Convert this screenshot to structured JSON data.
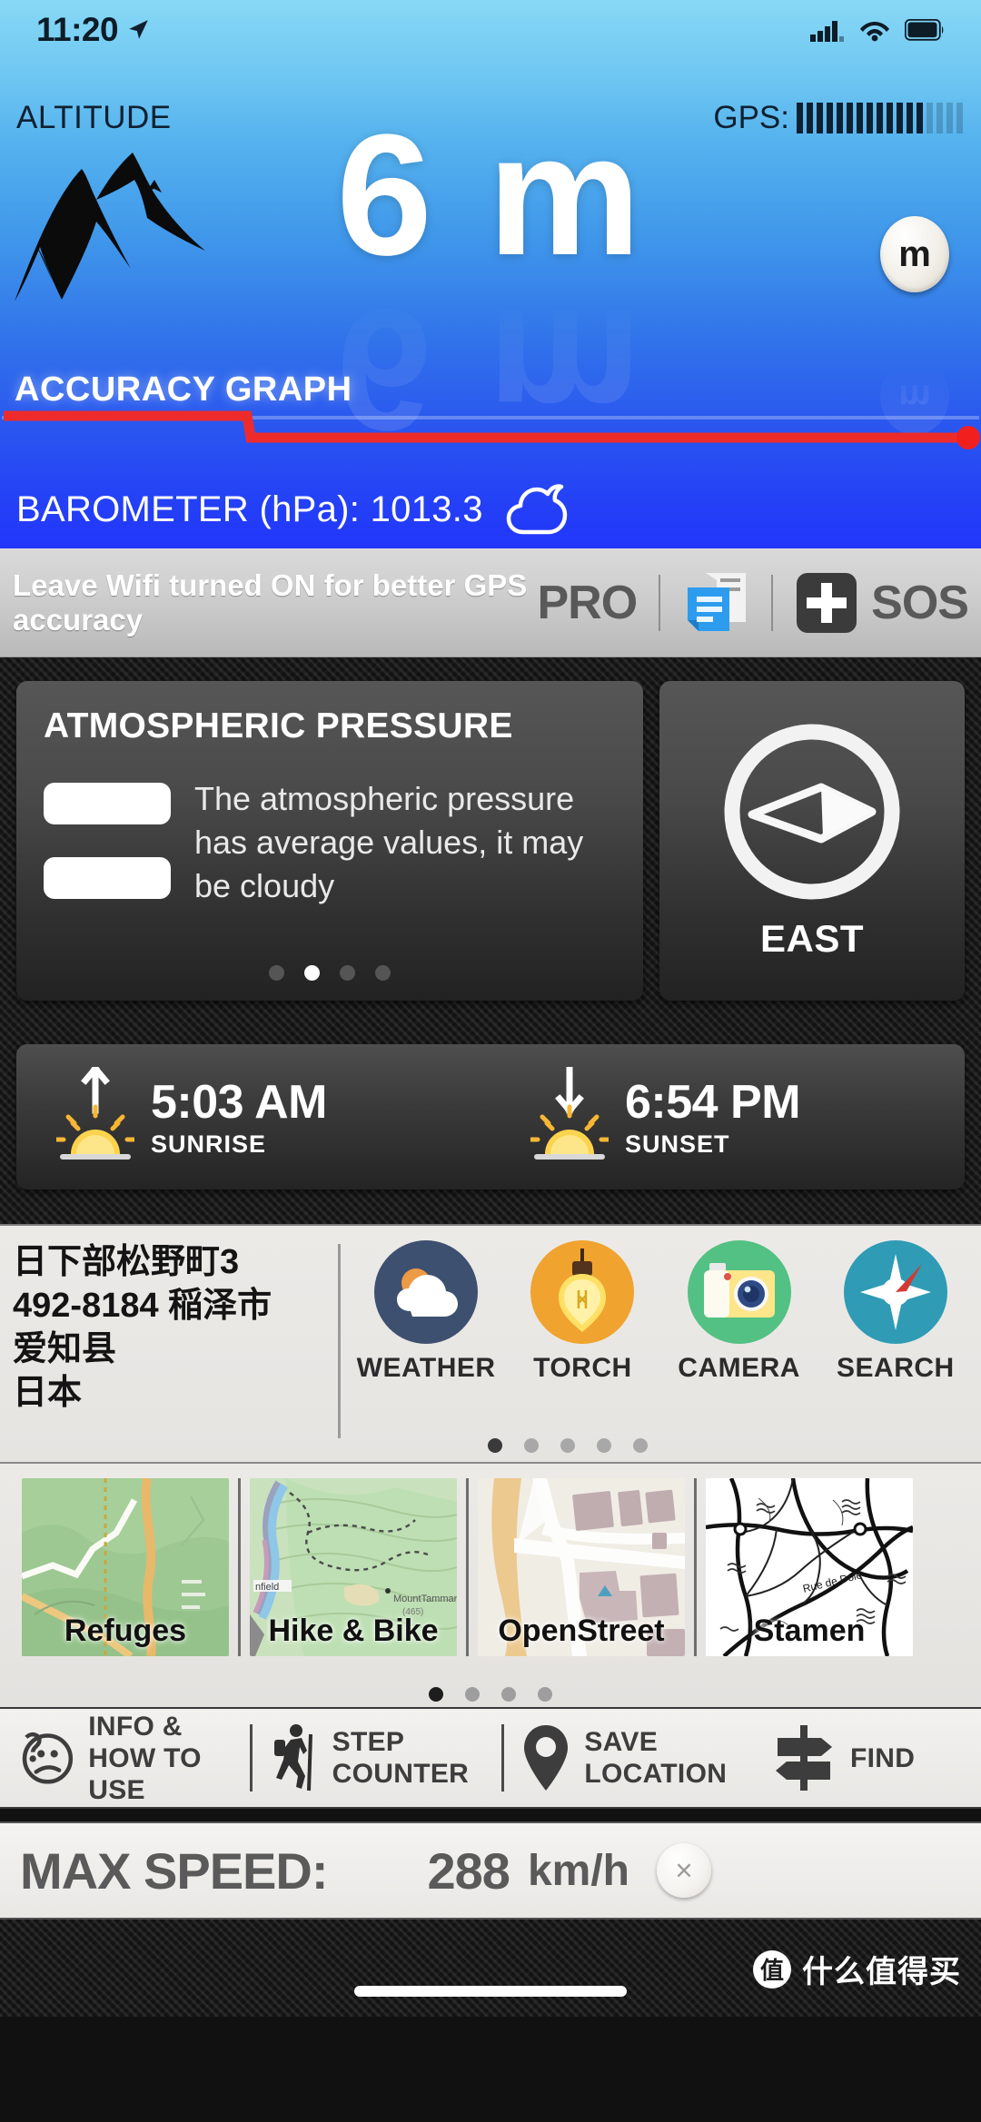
{
  "status_bar": {
    "time": "11:20",
    "location_arrow": "location-arrow-icon",
    "signal": "cellular-signal-icon",
    "wifi": "wifi-icon",
    "battery": "battery-icon"
  },
  "header": {
    "altitude_label": "ALTITUDE",
    "gps_label": "GPS:",
    "gps_bars_total": 17,
    "gps_bars_active": 13
  },
  "altitude": {
    "value": "6 m",
    "unit_button": "m",
    "mountain_icon": "mountain-icon"
  },
  "accuracy": {
    "label": "ACCURACY GRAPH",
    "line_color": "#ee2b2b"
  },
  "barometer": {
    "text": "BAROMETER (hPa): 1013.3",
    "value": "1013.3",
    "unit": "hPa",
    "cloud_icon": "cloud-icon"
  },
  "tipbar": {
    "tip": "Leave Wifi turned ON for better GPS accuracy",
    "pro_label": "PRO",
    "news_icon": "news-document-icon",
    "plus_icon": "plus-icon",
    "sos_label": "SOS"
  },
  "pressure_card": {
    "title": "ATMOSPHERIC PRESSURE",
    "icon": "equals-sign-icon",
    "description": "The atmospheric pressure has average values, it may be cloudy",
    "dots_total": 4,
    "dots_active_index": 1
  },
  "compass_card": {
    "direction": "EAST",
    "icon": "compass-needle-icon"
  },
  "sun_card": {
    "sunrise": {
      "time": "5:03 AM",
      "caption": "SUNRISE",
      "arrow": "arrow-up-icon",
      "icon": "sunrise-icon"
    },
    "sunset": {
      "time": "6:54 PM",
      "caption": "SUNSET",
      "arrow": "arrow-down-icon",
      "icon": "sunset-icon"
    }
  },
  "location": {
    "line1": "日下部松野町3",
    "line2": "492-8184 稲泽市",
    "line3": "爱知县",
    "line4": "日本"
  },
  "tools": {
    "items": [
      {
        "label": "WEATHER",
        "icon": "weather-sun-cloud-icon",
        "color": "#3e5070"
      },
      {
        "label": "TORCH",
        "icon": "torch-bulb-icon",
        "color": "#f0a32e"
      },
      {
        "label": "CAMERA",
        "icon": "camera-icon",
        "color": "#53c183"
      },
      {
        "label": "SEARCH",
        "icon": "compass-search-icon",
        "color": "#2f9bb5"
      }
    ],
    "dots_total": 5,
    "dots_active_index": 0
  },
  "maps": {
    "items": [
      {
        "label": "Refuges"
      },
      {
        "label": "Hike & Bike"
      },
      {
        "label": "OpenStreet"
      },
      {
        "label": "Stamen"
      }
    ],
    "dots_total": 4,
    "dots_active_index": 0
  },
  "actions": [
    {
      "label_line1": "INFO &",
      "label_line2": "HOW TO USE",
      "icon": "confused-face-icon"
    },
    {
      "label_line1": "STEP",
      "label_line2": "COUNTER",
      "icon": "hiker-icon"
    },
    {
      "label_line1": "SAVE",
      "label_line2": "LOCATION",
      "icon": "map-pin-icon"
    },
    {
      "label_line1": "FIND",
      "label_line2": "",
      "icon": "signpost-icon"
    }
  ],
  "max_speed": {
    "label": "MAX SPEED:",
    "value": "288",
    "unit": "km/h",
    "reset": "×"
  },
  "watermark": {
    "badge": "值",
    "text": "什么值得买"
  }
}
